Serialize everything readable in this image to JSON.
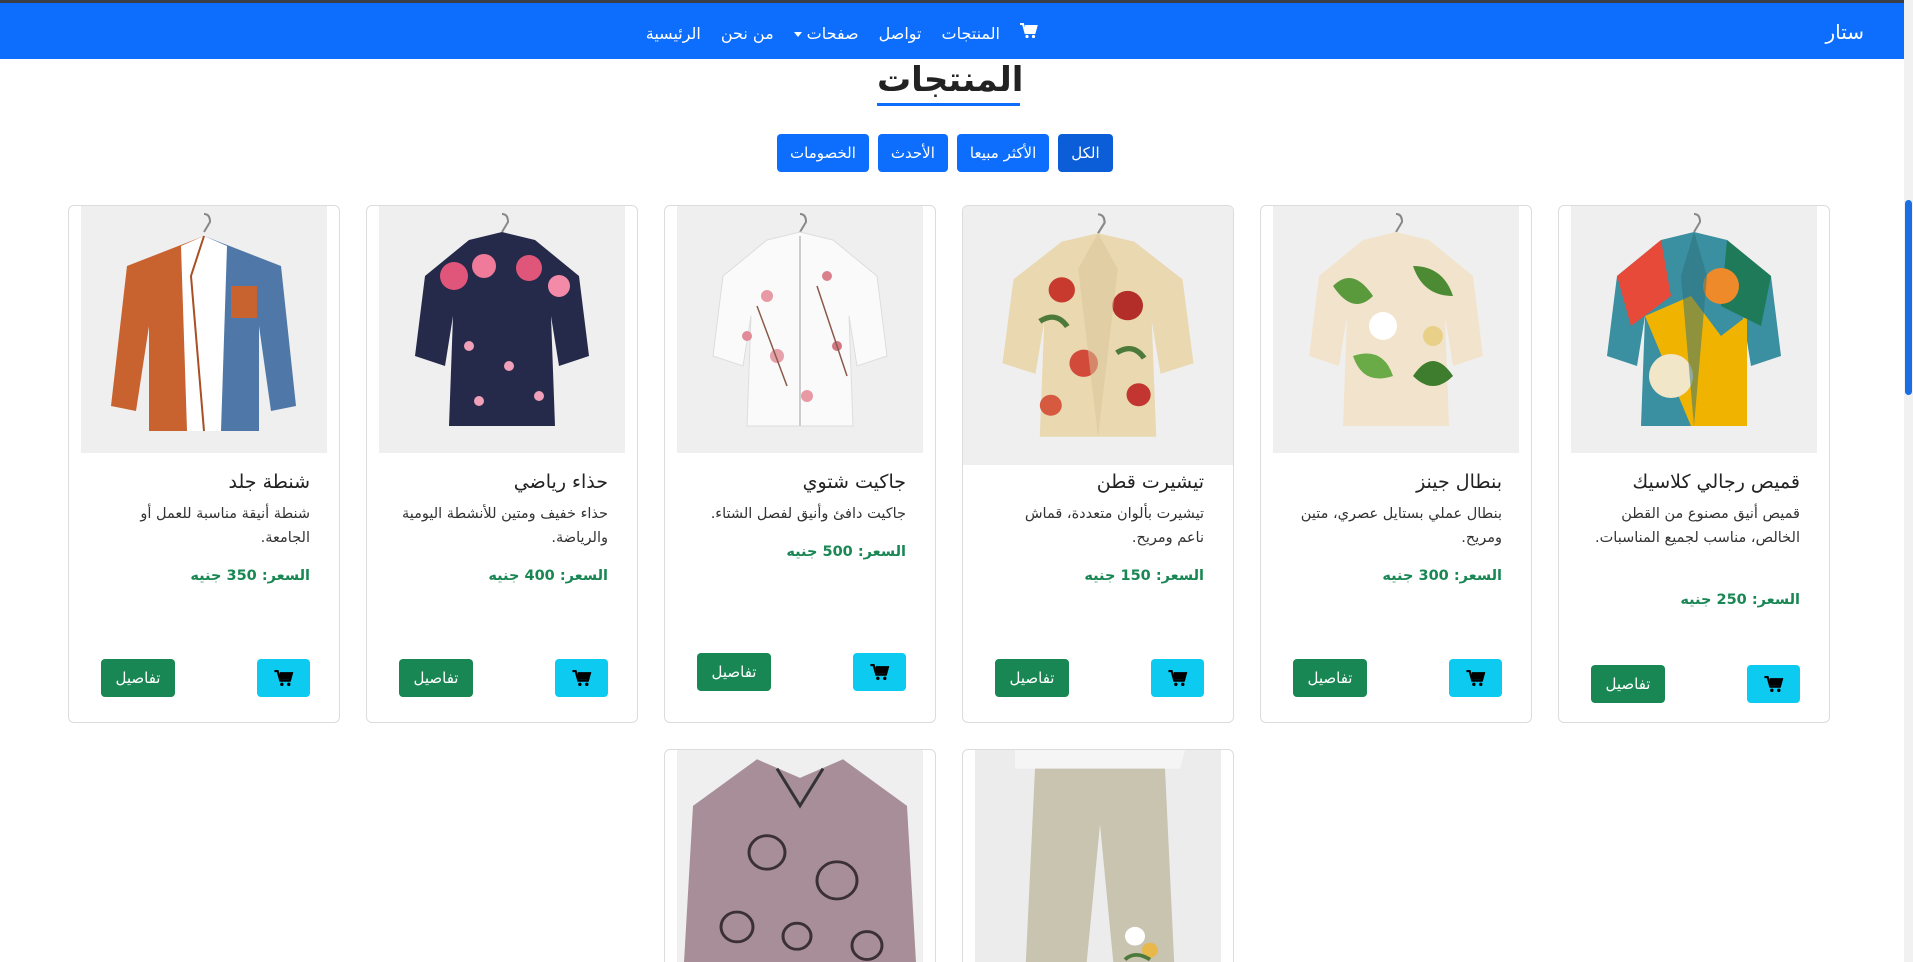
{
  "navbar": {
    "brand": "ستار",
    "links": [
      "الرئيسية",
      "من نحن",
      "صفحات",
      "تواصل",
      "المنتجات"
    ],
    "cart_icon": "cart-icon"
  },
  "section": {
    "title": "المنتجات"
  },
  "filters": [
    "الكل",
    "الأكثر مبيعا",
    "الأحدث",
    "الخصومات"
  ],
  "products": [
    {
      "name": "قميص رجالي كلاسيك",
      "desc": "قميص أنيق مصنوع من القطن الخالص، مناسب لجميع المناسبات.",
      "price": "السعر: 250 جنيه",
      "details": "تفاصيل",
      "image": "multicolor-floral-shirt"
    },
    {
      "name": "بنطال جينز",
      "desc": "بنطال عملي بستايل عصري، متين ومريح.",
      "price": "السعر: 300 جنيه",
      "details": "تفاصيل",
      "image": "green-leaf-shirt"
    },
    {
      "name": "تيشيرت قطن",
      "desc": "تيشيرت بألوان متعددة، قماش ناعم ومريح.",
      "price": "السعر: 150 جنيه",
      "details": "تفاصيل",
      "image": "red-floral-shirt"
    },
    {
      "name": "جاكيت شتوي",
      "desc": "جاكيت دافئ وأنيق لفصل الشتاء.",
      "price": "السعر: 500 جنيه",
      "details": "تفاصيل",
      "image": "pink-blossom-shirt"
    },
    {
      "name": "حذاء رياضي",
      "desc": "حذاء خفيف ومتين للأنشطة اليومية والرياضة.",
      "price": "السعر: 400 جنيه",
      "details": "تفاصيل",
      "image": "navy-floral-shirt"
    },
    {
      "name": "شنطة جلد",
      "desc": "شنطة أنيقة مناسبة للعمل أو الجامعة.",
      "price": "السعر: 350 جنيه",
      "details": "تفاصيل",
      "image": "orange-denim-shirt"
    }
  ],
  "lower_products": [
    {
      "image": "linen-pants"
    },
    {
      "image": "purple-pattern-blouse"
    }
  ],
  "colors": {
    "primary": "#0d6efd",
    "success": "#198754",
    "info": "#0dcaf0"
  }
}
